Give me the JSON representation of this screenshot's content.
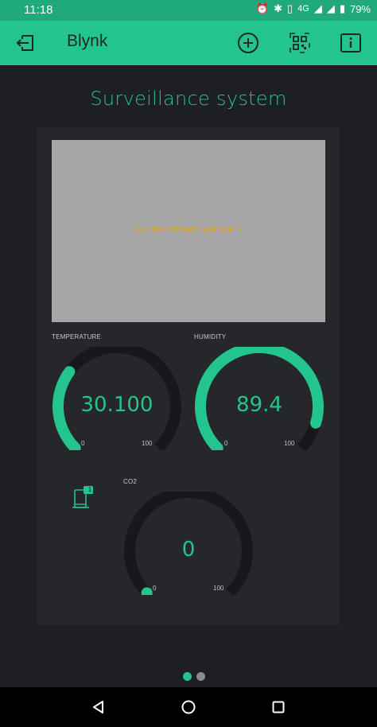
{
  "status_bar": {
    "time": "11:18",
    "network": "4G",
    "battery": "79%"
  },
  "app_bar": {
    "title": "Blynk",
    "icons": [
      "exit-icon",
      "add-icon",
      "qr-code-icon",
      "info-icon"
    ]
  },
  "project": {
    "name": "Surveillance system"
  },
  "video": {
    "message": "No video stream available :("
  },
  "widgets": {
    "temperature": {
      "label": "TEMPERATURE",
      "value": "30.100",
      "min": "0",
      "max": "100",
      "fraction": 0.301
    },
    "humidity": {
      "label": "HUMIDITY",
      "value": "89.4",
      "min": "0",
      "max": "100",
      "fraction": 0.894
    },
    "co2": {
      "label": "CO2",
      "value": "0",
      "min": "0",
      "max": "100",
      "fraction": 0.0
    },
    "device_badge": "1"
  },
  "pages": {
    "count": 2,
    "active": 0
  },
  "colors": {
    "accent": "#23c48e",
    "panel": "#25272b",
    "background": "#1d1f23",
    "track": "#17181b"
  }
}
